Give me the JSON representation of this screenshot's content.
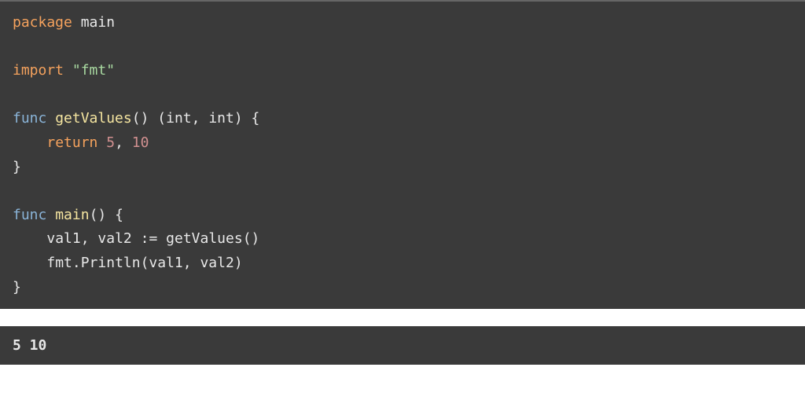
{
  "code": {
    "line1": {
      "kw": "package",
      "name": "main"
    },
    "line3": {
      "kw": "import",
      "value": "\"fmt\""
    },
    "line5": {
      "kw": "func",
      "name": "getValues",
      "params_open": "()",
      "ret_open": "(",
      "type1": "int",
      "comma": ",",
      "type2": "int",
      "ret_close": ")",
      "brace": "{"
    },
    "line6": {
      "indent": "    ",
      "kw": "return",
      "num1": "5",
      "comma": ",",
      "num2": "10"
    },
    "line7": {
      "brace": "}"
    },
    "line9": {
      "kw": "func",
      "name": "main",
      "params": "()",
      "brace": "{"
    },
    "line10": {
      "indent": "    ",
      "v1": "val1",
      "comma": ",",
      "v2": "val2",
      "op": ":=",
      "call": "getValues",
      "parens": "()"
    },
    "line11": {
      "indent": "    ",
      "pkg": "fmt",
      "dot": ".",
      "fn": "Println",
      "open": "(",
      "a1": "val1",
      "comma": ",",
      "a2": "val2",
      "close": ")"
    },
    "line12": {
      "brace": "}"
    }
  },
  "output": "5 10"
}
